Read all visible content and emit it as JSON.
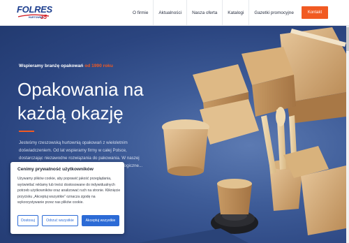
{
  "header": {
    "logo": {
      "word": "FOLRES",
      "tagline": "HURTOWNIA",
      "anniversary": "35"
    },
    "nav": [
      {
        "label": "O firmie"
      },
      {
        "label": "Aktualności"
      },
      {
        "label": "Nasza oferta"
      },
      {
        "label": "Katalogi"
      },
      {
        "label": "Gazetki promocyjne"
      }
    ],
    "cta": "Kontakt"
  },
  "hero": {
    "eyebrow_prefix": "Wspieramy branżę opakowań",
    "eyebrow_highlight": "od 1990 roku",
    "headline_line1": "Opakowania na",
    "headline_line2": "każdą okazję",
    "description": "Jesteśmy rzeszowską hurtownią opakowań z wieloletnim doświadczeniem. Od lat wspieramy firmy w całej Polsce, dostarczając niezawodne rozwiązania do pakowania. W naszej ofercie znajdziesz m.in. opakowania jednorazowe, ekologiczne..."
  },
  "cookie": {
    "title": "Cenimy prywatność użytkowników",
    "text": "Używamy plików cookie, aby poprawić jakość przeglądania, wyświetlać reklamy lub treści dostosowane do indywidualnych potrzeb użytkowników oraz analizować ruch na stronie. Kliknięcie przycisku „Akceptuj wszystkie” oznacza zgodę na wykorzystywanie przez nas plików cookie.",
    "btn_customize": "Dostosuj",
    "btn_reject": "Odrzuć wszystkie",
    "btn_accept": "Akceptuj wszystkie"
  },
  "colors": {
    "accent": "#f15a22",
    "brand": "#1e3f8f",
    "cookie_button": "#2c6bd6",
    "hero_bg": "#2f4a86"
  }
}
